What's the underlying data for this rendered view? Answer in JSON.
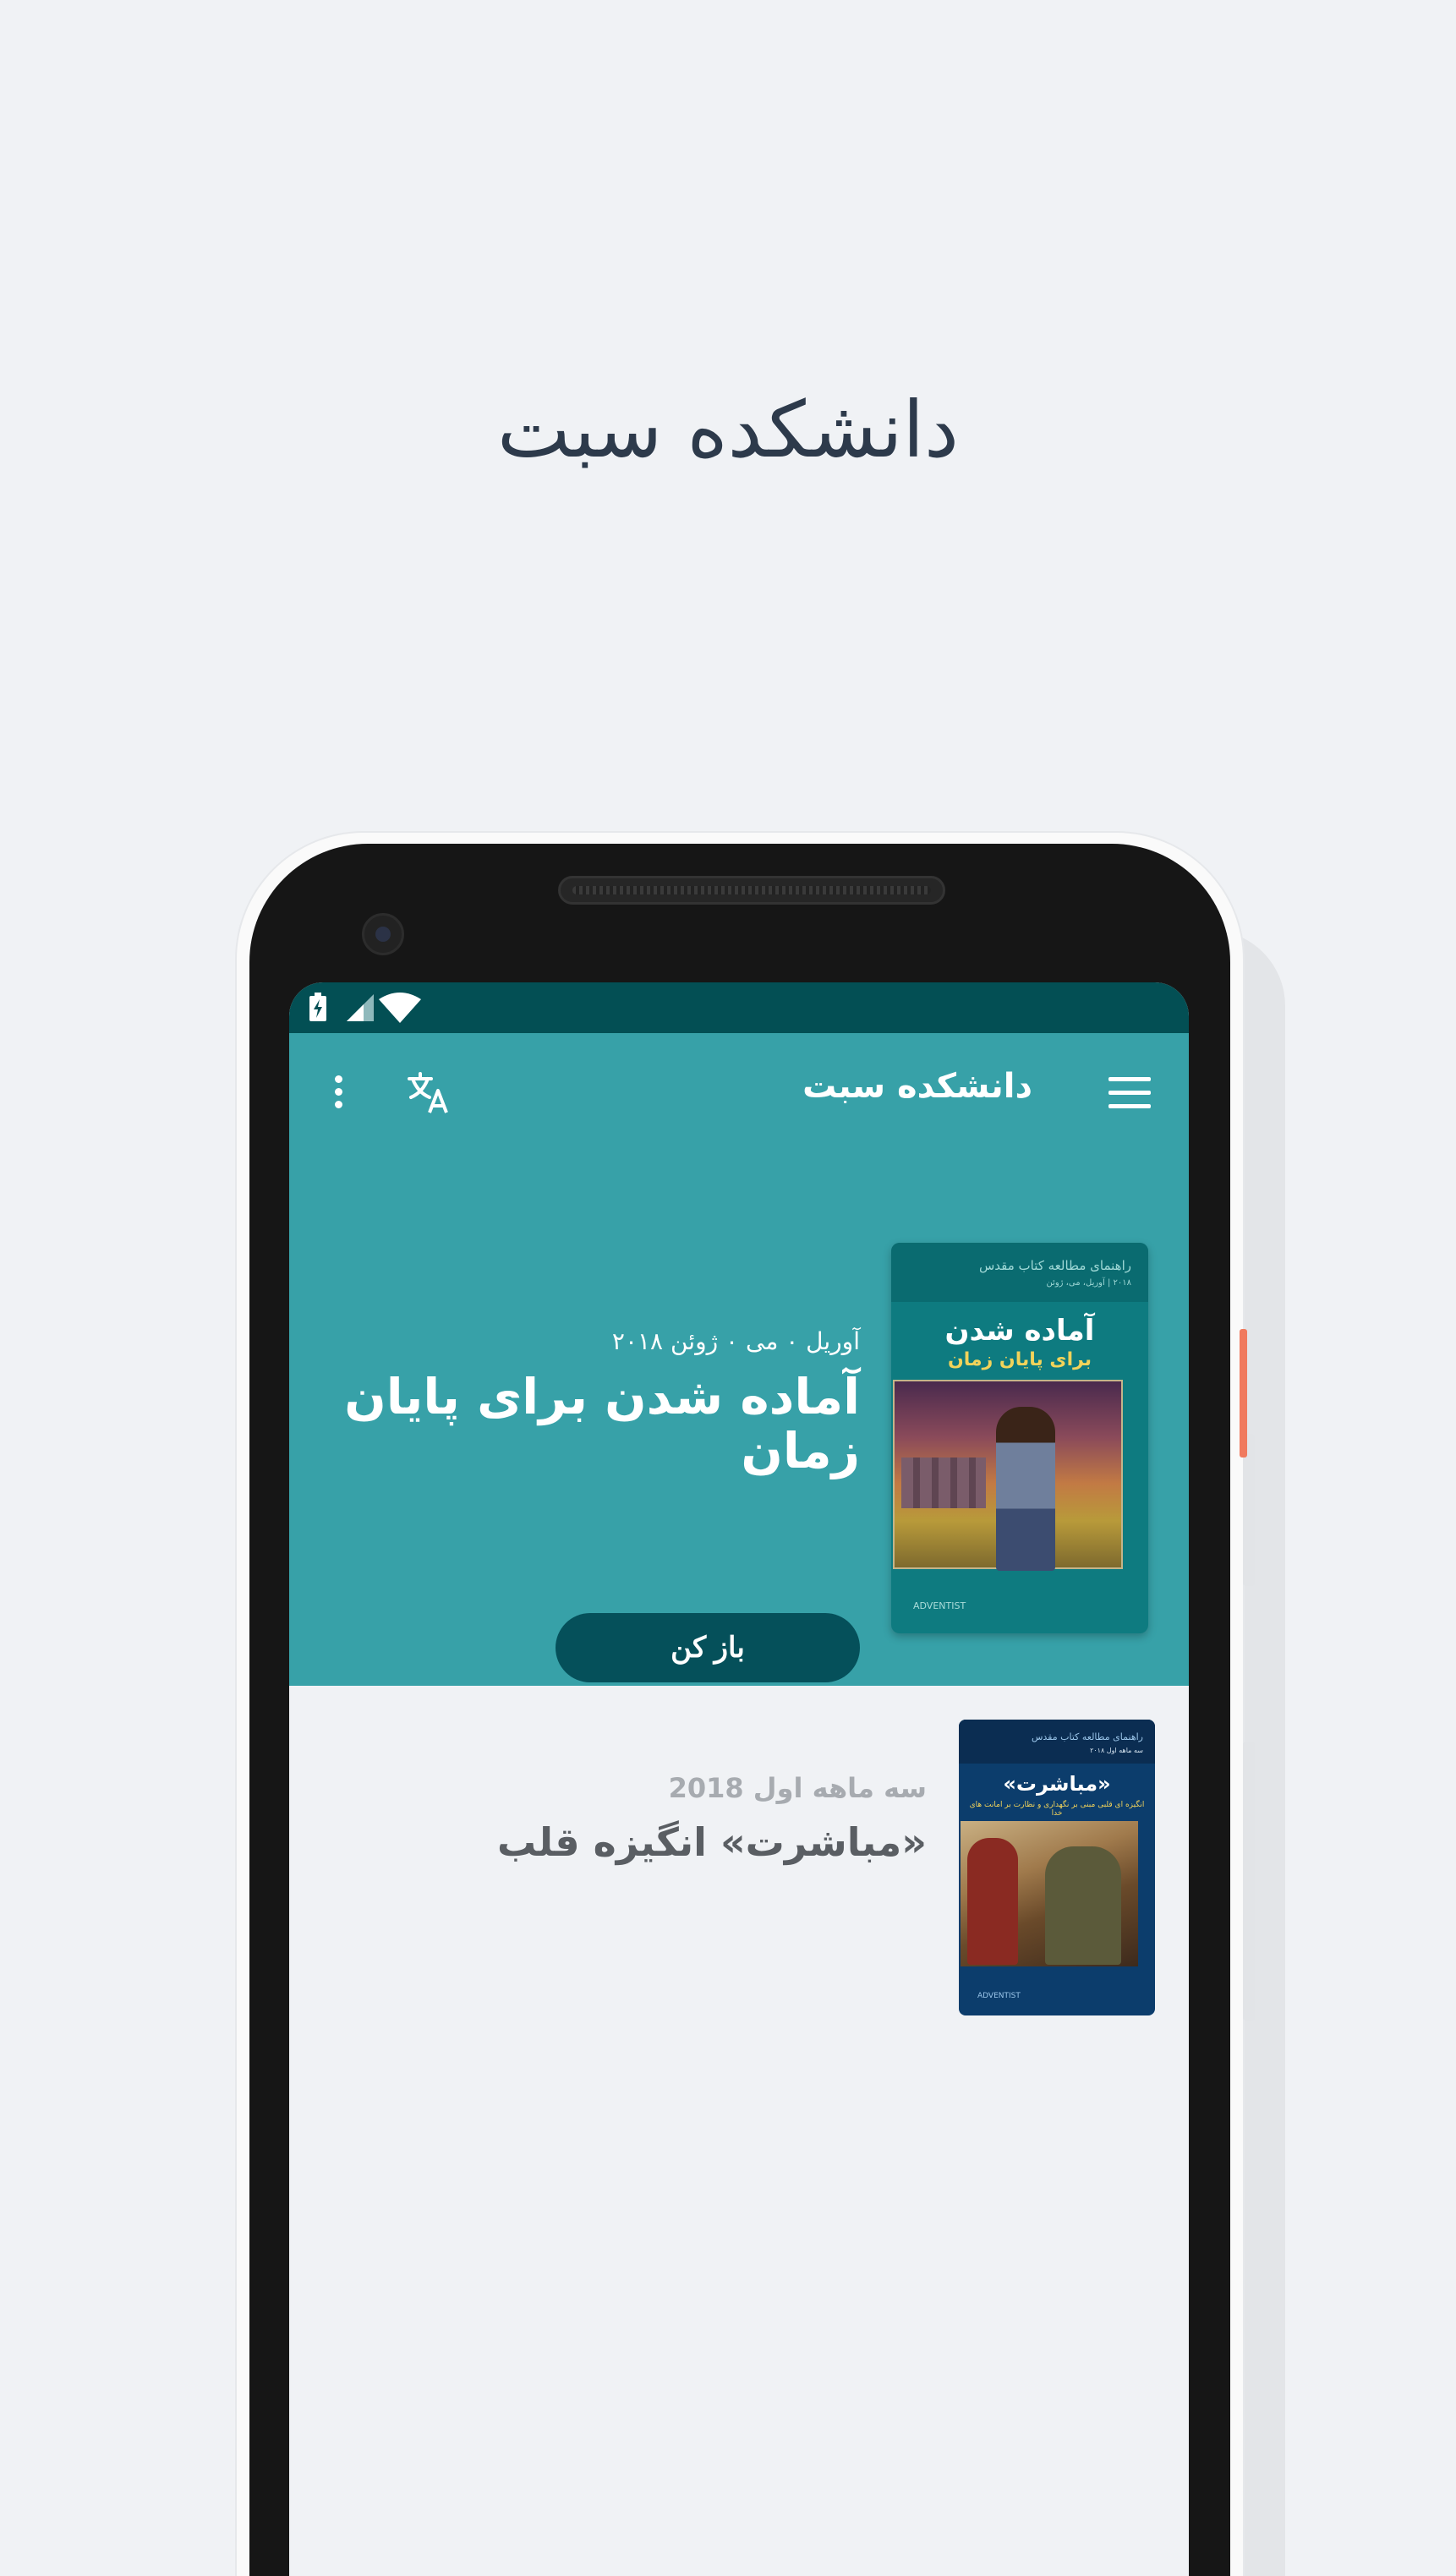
{
  "promo": {
    "headline": "دانشکده سبت"
  },
  "app_bar": {
    "title": "دانشکده سبت",
    "menu_icon": "hamburger-menu-icon",
    "translate_icon": "translate-icon",
    "more_icon": "more-vertical-icon"
  },
  "status_bar": {
    "icons": [
      "battery-charging-icon",
      "cell-signal-icon",
      "wifi-icon"
    ]
  },
  "featured": {
    "date": "آوریل ۰ می ۰ ژوئن ۲۰۱۸",
    "title": "آماده شدن برای پایان زمان",
    "open_button": "باز کن",
    "cover": {
      "header": "راهنمای مطالعه کتاب مقدس",
      "subheader": "۲۰۱۸ | آوریل، می، ژوئن",
      "title": "آماده شدن",
      "subtitle": "برای پایان زمان",
      "logo": "ADVENTIST"
    }
  },
  "quarterlies": [
    {
      "subtitle": "سه ماهه اول 2018",
      "title": "«مباشرت» انگیزه قلب",
      "cover": {
        "header": "راهنمای مطالعه کتاب مقدس",
        "subheader": "سه ماهه اول ۲۰۱۸",
        "title": "«مباشرت»",
        "subtitle": "انگیزه ای قلبی مبنی بر نگهداری و نظارت بر امانت های خدا",
        "logo": "ADVENTIST"
      }
    }
  ],
  "colors": {
    "status_bar": "#034f54",
    "primary": "#37a1a8",
    "button": "#05505a",
    "page_bg": "#f0f2f5"
  }
}
